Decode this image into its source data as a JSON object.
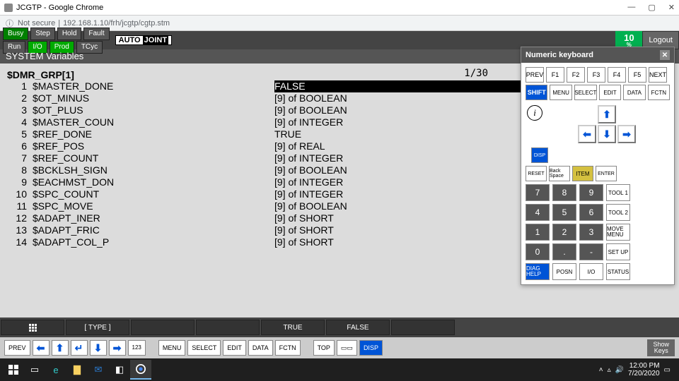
{
  "window": {
    "title": "JCGTP - Google Chrome",
    "url": "192.168.1.10/frh/jcgtp/cgtp.stm",
    "not_secure": "Not secure",
    "minimize": "—",
    "maximize": "▢",
    "close": "✕"
  },
  "status_bar": {
    "busy": "Busy",
    "step": "Step",
    "hold": "Hold",
    "fault": "Fault",
    "run": "Run",
    "io": "I/O",
    "prod": "Prod",
    "tcyc": "TCyc",
    "mode_auto": "AUTO",
    "mode_joint": "JOINT",
    "percent": "10",
    "percent_unit": "%",
    "logout": "Logout"
  },
  "app": {
    "title": "SYSTEM Variables",
    "header": "$DMR_GRP[1]",
    "page_counter": "1/30",
    "rows": [
      {
        "idx": "1",
        "name": "$MASTER_DONE",
        "val": "FALSE",
        "hl": true
      },
      {
        "idx": "2",
        "name": "$OT_MINUS",
        "val": "[9] of BOOLEAN"
      },
      {
        "idx": "3",
        "name": "$OT_PLUS",
        "val": "[9] of BOOLEAN"
      },
      {
        "idx": "4",
        "name": "$MASTER_COUN",
        "val": "[9] of INTEGER"
      },
      {
        "idx": "5",
        "name": "$REF_DONE",
        "val": "TRUE"
      },
      {
        "idx": "6",
        "name": "$REF_POS",
        "val": "[9] of REAL"
      },
      {
        "idx": "7",
        "name": "$REF_COUNT",
        "val": "[9] of INTEGER"
      },
      {
        "idx": "8",
        "name": "$BCKLSH_SIGN",
        "val": "[9] of BOOLEAN"
      },
      {
        "idx": "9",
        "name": "$EACHMST_DON",
        "val": "[9] of INTEGER"
      },
      {
        "idx": "10",
        "name": "$SPC_COUNT",
        "val": "[9] of INTEGER"
      },
      {
        "idx": "11",
        "name": "$SPC_MOVE",
        "val": "[9] of BOOLEAN"
      },
      {
        "idx": "12",
        "name": "$ADAPT_INER",
        "val": "[9] of SHORT"
      },
      {
        "idx": "13",
        "name": "$ADAPT_FRIC",
        "val": "[9] of SHORT"
      },
      {
        "idx": "14",
        "name": "$ADAPT_COL_P",
        "val": "[9] of SHORT"
      }
    ],
    "soft_keys": {
      "type": "[ TYPE ]",
      "true": "TRUE",
      "false": "FALSE"
    }
  },
  "numkb": {
    "title": "Numeric keyboard",
    "prev": "PREV",
    "f1": "F1",
    "f2": "F2",
    "f3": "F3",
    "f4": "F4",
    "f5": "F5",
    "next": "NEXT",
    "shift": "SHIFT",
    "menu": "MENU",
    "select": "SELECT",
    "edit": "EDIT",
    "data": "DATA",
    "fctn": "FCTN",
    "disp": "DISP",
    "reset": "RESET",
    "bs": "Back Space",
    "item": "ITEM",
    "enter": "ENTER",
    "n7": "7",
    "n8": "8",
    "n9": "9",
    "tool1": "TOOL 1",
    "n4": "4",
    "n5": "5",
    "n6": "6",
    "tool2": "TOOL 2",
    "n1": "1",
    "n2": "2",
    "n3": "3",
    "movemenu": "MOVE MENU",
    "n0": "0",
    "dot": ".",
    "minus": "-",
    "setup": "SET UP",
    "diag": "DIAG HELP",
    "posn": "POSN",
    "ioL": "I/O",
    "status": "STATUS"
  },
  "bottom_bar": {
    "prev": "PREV",
    "menu": "MENU",
    "select": "SELECT",
    "edit": "EDIT",
    "data": "DATA",
    "fctn": "FCTN",
    "top": "TOP",
    "disp": "DISP",
    "key123": "123",
    "show_keys1": "Show",
    "show_keys2": "Keys"
  },
  "taskbar": {
    "time": "12:00 PM",
    "date": "7/20/2020"
  }
}
